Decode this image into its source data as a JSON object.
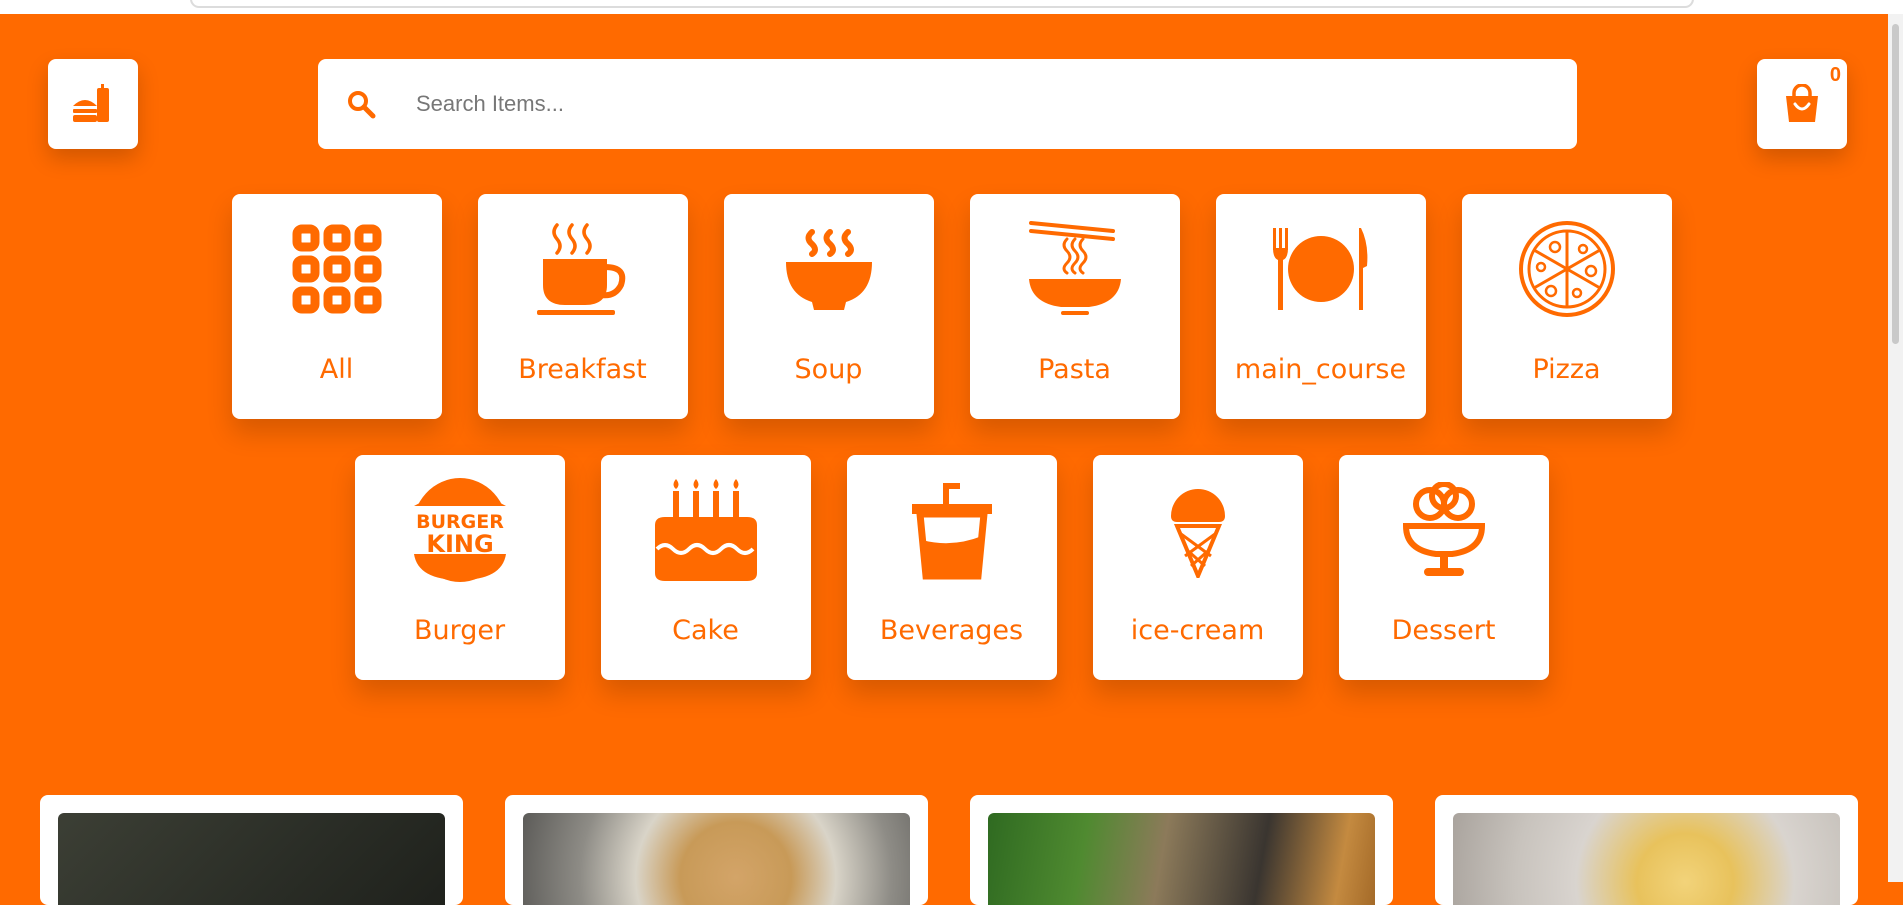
{
  "search": {
    "placeholder": "Search Items..."
  },
  "cart": {
    "count": "0",
    "icon": "shopping-bag-icon"
  },
  "logo": {
    "icon": "burger-drink-icon"
  },
  "brand_color": "#ff6a00",
  "categories": [
    {
      "label": "All",
      "icon": "grid-icon"
    },
    {
      "label": "Breakfast",
      "icon": "coffee-cup-icon"
    },
    {
      "label": "Soup",
      "icon": "soup-bowl-icon"
    },
    {
      "label": "Pasta",
      "icon": "noodle-bowl-icon"
    },
    {
      "label": "main_course",
      "icon": "plate-cutlery-icon"
    },
    {
      "label": "Pizza",
      "icon": "pizza-icon"
    },
    {
      "label": "Burger",
      "icon": "burger-king-icon",
      "logo_text": [
        "BURGER",
        "KING"
      ]
    },
    {
      "label": "Cake",
      "icon": "birthday-cake-icon"
    },
    {
      "label": "Beverages",
      "icon": "cup-straw-icon"
    },
    {
      "label": "ice-cream",
      "icon": "ice-cream-cone-icon"
    },
    {
      "label": "Dessert",
      "icon": "sundae-icon"
    }
  ],
  "food_cards": [
    {
      "image": "dark-dish-photo"
    },
    {
      "image": "soup-bowl-photo"
    },
    {
      "image": "grilled-vegetables-photo"
    },
    {
      "image": "pasta-plate-photo"
    }
  ]
}
